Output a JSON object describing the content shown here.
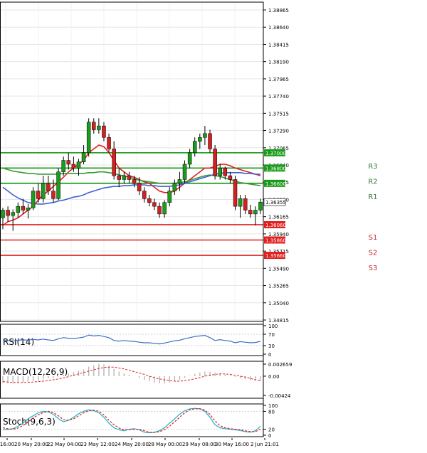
{
  "chart_data": [
    {
      "type": "candlestick",
      "title": "",
      "ylim": [
        1.34815,
        1.38865
      ],
      "y_ticks": [
        "1.38865",
        "1.38640",
        "1.38415",
        "1.38190",
        "1.37965",
        "1.37740",
        "1.37515",
        "1.37290",
        "1.37065",
        "1.36840",
        "1.36615",
        "1.36390",
        "1.36165",
        "1.35940",
        "1.35715",
        "1.35490",
        "1.35265",
        "1.35040",
        "1.34815"
      ],
      "x_labels": [
        "16:00",
        "20 May 20:00",
        "22 May 04:00",
        "23 May 12:00",
        "24 May 20:00",
        "28 May 00:00",
        "29 May 08:00",
        "30 May 16:00",
        "2 Jun 21:01"
      ],
      "current_price": "1.36355",
      "levels": [
        {
          "name": "R3",
          "value": 1.37,
          "label": "1.37000",
          "color": "#1a9c1a"
        },
        {
          "name": "R2",
          "value": 1.368,
          "label": "1.36800",
          "color": "#1a9c1a"
        },
        {
          "name": "R1",
          "value": 1.366,
          "label": "1.36600",
          "color": "#1a9c1a"
        },
        {
          "name": "S1",
          "value": 1.3606,
          "label": "1.36060",
          "color": "#e02020"
        },
        {
          "name": "S2",
          "value": 1.3586,
          "label": "1.35860",
          "color": "#e02020"
        },
        {
          "name": "S3",
          "value": 1.3566,
          "label": "1.35660",
          "color": "#e02020"
        }
      ],
      "candles": [
        [
          1.3615,
          1.3628,
          1.36,
          1.3625
        ],
        [
          1.3625,
          1.363,
          1.361,
          1.3618
        ],
        [
          1.3618,
          1.3626,
          1.3598,
          1.3622
        ],
        [
          1.3622,
          1.3635,
          1.3615,
          1.363
        ],
        [
          1.363,
          1.364,
          1.362,
          1.3625
        ],
        [
          1.3625,
          1.3633,
          1.3614,
          1.3628
        ],
        [
          1.3628,
          1.3655,
          1.3625,
          1.365
        ],
        [
          1.365,
          1.366,
          1.3635,
          1.364
        ],
        [
          1.364,
          1.367,
          1.3635,
          1.366
        ],
        [
          1.366,
          1.367,
          1.3645,
          1.365
        ],
        [
          1.365,
          1.3665,
          1.3635,
          1.364
        ],
        [
          1.364,
          1.368,
          1.3638,
          1.3675
        ],
        [
          1.3675,
          1.3695,
          1.367,
          1.369
        ],
        [
          1.369,
          1.37,
          1.3678,
          1.3685
        ],
        [
          1.3685,
          1.3695,
          1.3675,
          1.368
        ],
        [
          1.368,
          1.3692,
          1.367,
          1.3688
        ],
        [
          1.3688,
          1.371,
          1.3685,
          1.37
        ],
        [
          1.37,
          1.3745,
          1.3695,
          1.374
        ],
        [
          1.374,
          1.3745,
          1.3725,
          1.373
        ],
        [
          1.373,
          1.3745,
          1.3725,
          1.3735
        ],
        [
          1.3735,
          1.374,
          1.3715,
          1.372
        ],
        [
          1.372,
          1.3725,
          1.37,
          1.3705
        ],
        [
          1.3705,
          1.3715,
          1.3665,
          1.367
        ],
        [
          1.367,
          1.368,
          1.3655,
          1.3665
        ],
        [
          1.3665,
          1.3675,
          1.366,
          1.367
        ],
        [
          1.367,
          1.3675,
          1.366,
          1.3665
        ],
        [
          1.3665,
          1.367,
          1.3655,
          1.366
        ],
        [
          1.366,
          1.3668,
          1.3645,
          1.365
        ],
        [
          1.365,
          1.3655,
          1.3635,
          1.364
        ],
        [
          1.364,
          1.3645,
          1.363,
          1.3635
        ],
        [
          1.3635,
          1.364,
          1.3625,
          1.363
        ],
        [
          1.363,
          1.3635,
          1.3615,
          1.362
        ],
        [
          1.362,
          1.3638,
          1.3615,
          1.3635
        ],
        [
          1.3635,
          1.3655,
          1.363,
          1.365
        ],
        [
          1.365,
          1.3665,
          1.3645,
          1.366
        ],
        [
          1.366,
          1.3675,
          1.365,
          1.3665
        ],
        [
          1.3665,
          1.369,
          1.366,
          1.3685
        ],
        [
          1.3685,
          1.3705,
          1.368,
          1.37
        ],
        [
          1.37,
          1.372,
          1.3695,
          1.3715
        ],
        [
          1.3715,
          1.3725,
          1.3705,
          1.372
        ],
        [
          1.372,
          1.3735,
          1.371,
          1.3725
        ],
        [
          1.3725,
          1.373,
          1.37,
          1.3705
        ],
        [
          1.3705,
          1.371,
          1.3665,
          1.367
        ],
        [
          1.367,
          1.3685,
          1.3665,
          1.368
        ],
        [
          1.368,
          1.3682,
          1.3665,
          1.367
        ],
        [
          1.367,
          1.3675,
          1.366,
          1.3665
        ],
        [
          1.3665,
          1.367,
          1.3625,
          1.363
        ],
        [
          1.363,
          1.3645,
          1.3615,
          1.364
        ],
        [
          1.364,
          1.3645,
          1.362,
          1.3625
        ],
        [
          1.3625,
          1.3632,
          1.3615,
          1.362
        ],
        [
          1.362,
          1.363,
          1.3605,
          1.3625
        ],
        [
          1.3625,
          1.364,
          1.362,
          1.36355
        ]
      ],
      "ma_series": [
        {
          "color": "#e02020",
          "values": [
            1.3605,
            1.361,
            1.3612,
            1.3615,
            1.362,
            1.3625,
            1.363,
            1.3638,
            1.3645,
            1.365,
            1.3656,
            1.3662,
            1.3668,
            1.3675,
            1.368,
            1.3685,
            1.369,
            1.37,
            1.3705,
            1.371,
            1.3708,
            1.37,
            1.369,
            1.368,
            1.3675,
            1.367,
            1.3668,
            1.3665,
            1.3662,
            1.366,
            1.3655,
            1.365,
            1.3648,
            1.3648,
            1.365,
            1.3655,
            1.366,
            1.3665,
            1.367,
            1.3675,
            1.368,
            1.368,
            1.3682,
            1.3685,
            1.3685,
            1.3683,
            1.368,
            1.3678,
            1.3676,
            1.3674,
            1.3672,
            1.367
          ]
        },
        {
          "color": "#3a9a3a",
          "values": [
            1.368,
            1.3678,
            1.3676,
            1.3675,
            1.3674,
            1.3673,
            1.3673,
            1.3672,
            1.3672,
            1.3672,
            1.3672,
            1.3672,
            1.3673,
            1.3673,
            1.3673,
            1.3673,
            1.3673,
            1.3674,
            1.3674,
            1.3675,
            1.3675,
            1.3674,
            1.3673,
            1.3671,
            1.367,
            1.3668,
            1.3666,
            1.3664,
            1.3663,
            1.3662,
            1.3661,
            1.366,
            1.366,
            1.366,
            1.366,
            1.3661,
            1.3662,
            1.3664,
            1.3666,
            1.3668,
            1.367,
            1.3671,
            1.367,
            1.3669,
            1.3667,
            1.3665,
            1.3663,
            1.3661,
            1.366,
            1.3659,
            1.3658,
            1.3657
          ]
        },
        {
          "color": "#4060d0",
          "values": [
            1.3655,
            1.365,
            1.3645,
            1.3641,
            1.3638,
            1.3635,
            1.3634,
            1.3633,
            1.3633,
            1.3634,
            1.3635,
            1.3637,
            1.3638,
            1.364,
            1.3642,
            1.3643,
            1.3645,
            1.3648,
            1.365,
            1.3652,
            1.3654,
            1.3655,
            1.3656,
            1.3656,
            1.3657,
            1.3657,
            1.3658,
            1.3658,
            1.3658,
            1.3657,
            1.3657,
            1.3656,
            1.3656,
            1.3656,
            1.3657,
            1.3658,
            1.366,
            1.3662,
            1.3664,
            1.3666,
            1.3668,
            1.367,
            1.3672,
            1.3673,
            1.3674,
            1.3674,
            1.3674,
            1.3674,
            1.3673,
            1.3673,
            1.3672,
            1.3672
          ]
        }
      ]
    },
    {
      "type": "line",
      "title": "RSI(14)",
      "ylim": [
        0,
        100
      ],
      "y_ticks": [
        "100",
        "70",
        "30",
        "0"
      ],
      "series": [
        {
          "color": "#3b6fc4",
          "values": [
            50,
            48,
            47,
            49,
            50,
            49,
            52,
            50,
            53,
            50,
            48,
            54,
            58,
            56,
            55,
            57,
            60,
            67,
            64,
            66,
            62,
            58,
            48,
            46,
            48,
            46,
            45,
            42,
            40,
            40,
            38,
            36,
            39,
            43,
            47,
            49,
            54,
            58,
            62,
            64,
            66,
            58,
            48,
            51,
            48,
            46,
            40,
            44,
            42,
            40,
            41,
            45
          ]
        }
      ]
    },
    {
      "type": "bar",
      "title": "MACD(12,26,9)",
      "ylim": [
        -0.00424,
        0.002659
      ],
      "y_ticks": [
        "0.002659",
        "0.00",
        "-0.00424"
      ],
      "histogram": [
        -0.0015,
        -0.0016,
        -0.0016,
        -0.0015,
        -0.0014,
        -0.0013,
        -0.0011,
        -0.001,
        -0.0007,
        -0.0005,
        -0.0004,
        -0.0001,
        0.0003,
        0.0006,
        0.0009,
        0.0012,
        0.0015,
        0.0021,
        0.0024,
        0.0027,
        0.0026,
        0.0023,
        0.0016,
        0.001,
        0.0006,
        0.0003,
        0.0,
        -0.0004,
        -0.0008,
        -0.0011,
        -0.0014,
        -0.0016,
        -0.0016,
        -0.0014,
        -0.0012,
        -0.0008,
        -0.0004,
        0.0001,
        0.0005,
        0.0008,
        0.001,
        0.001,
        0.0008,
        0.0006,
        0.0004,
        0.0002,
        -0.0002,
        -0.0005,
        -0.0007,
        -0.0009,
        -0.001,
        -0.0011
      ],
      "signal": {
        "color": "#e02020",
        "values": [
          -0.0012,
          -0.0013,
          -0.0014,
          -0.0014,
          -0.0014,
          -0.0014,
          -0.0013,
          -0.0012,
          -0.0011,
          -0.001,
          -0.0008,
          -0.0006,
          -0.0004,
          -0.0001,
          0.0002,
          0.0005,
          0.0008,
          0.0011,
          0.0014,
          0.0017,
          0.0019,
          0.002,
          0.002,
          0.0018,
          0.0016,
          0.0013,
          0.001,
          0.0007,
          0.0004,
          0.0,
          -0.0003,
          -0.0006,
          -0.0008,
          -0.001,
          -0.0011,
          -0.0011,
          -0.001,
          -0.0008,
          -0.0006,
          -0.0003,
          0.0,
          0.0002,
          0.0004,
          0.0005,
          0.0005,
          0.0004,
          0.0002,
          0.0,
          -0.0002,
          -0.0005,
          -0.0008,
          -0.001
        ]
      }
    },
    {
      "type": "line",
      "title": "Stoch(9,6,3)",
      "ylim": [
        0,
        100
      ],
      "y_ticks": [
        "100",
        "80",
        "20",
        "0"
      ],
      "series": [
        {
          "color": "#1fb0c8",
          "values": [
            20,
            18,
            22,
            30,
            40,
            55,
            65,
            75,
            80,
            78,
            70,
            55,
            45,
            50,
            60,
            72,
            80,
            85,
            82,
            75,
            60,
            40,
            25,
            18,
            15,
            20,
            22,
            18,
            10,
            8,
            10,
            15,
            25,
            40,
            55,
            70,
            82,
            88,
            90,
            88,
            80,
            60,
            35,
            25,
            22,
            20,
            18,
            16,
            12,
            10,
            15,
            30
          ]
        },
        {
          "color": "#e02020",
          "values": [
            25,
            22,
            20,
            24,
            32,
            45,
            58,
            68,
            76,
            80,
            76,
            65,
            52,
            50,
            55,
            65,
            75,
            82,
            84,
            80,
            68,
            50,
            35,
            24,
            18,
            19,
            20,
            20,
            15,
            10,
            9,
            12,
            18,
            30,
            45,
            60,
            75,
            85,
            88,
            89,
            84,
            70,
            48,
            32,
            25,
            22,
            20,
            18,
            15,
            12,
            12,
            20
          ]
        }
      ]
    }
  ]
}
